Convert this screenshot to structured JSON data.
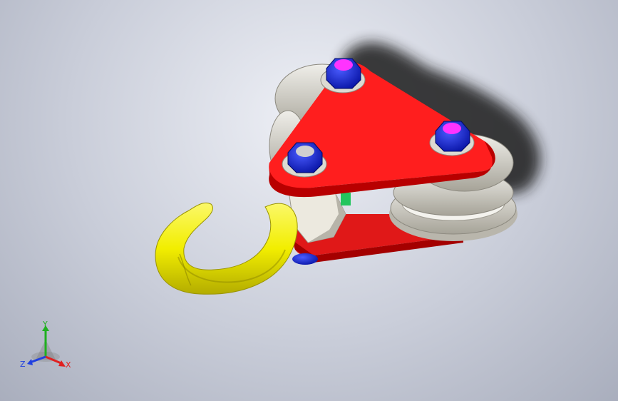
{
  "viewport": {
    "background_top": "#eef0f6",
    "background_bottom": "#a9aebd"
  },
  "model": {
    "colors": {
      "side_plate": "#ff2020",
      "side_plate_edge": "#b00000",
      "hook": "#f5f000",
      "hook_shade": "#b8b000",
      "sheave": "#d9d7cf",
      "sheave_shade": "#a9a69c",
      "nut": "#1a2cff",
      "bolt_end_magenta": "#ff33ff",
      "bolt_end_grey": "#d0d0d0",
      "swivel_block": "#e6e3d8",
      "spacer": "#22c55e",
      "shadow": "#2a2a2a"
    }
  },
  "triad": {
    "x_label": "X",
    "y_label": "Y",
    "z_label": "Z",
    "x_color": "#e02020",
    "y_color": "#20b020",
    "z_color": "#2040e0"
  }
}
